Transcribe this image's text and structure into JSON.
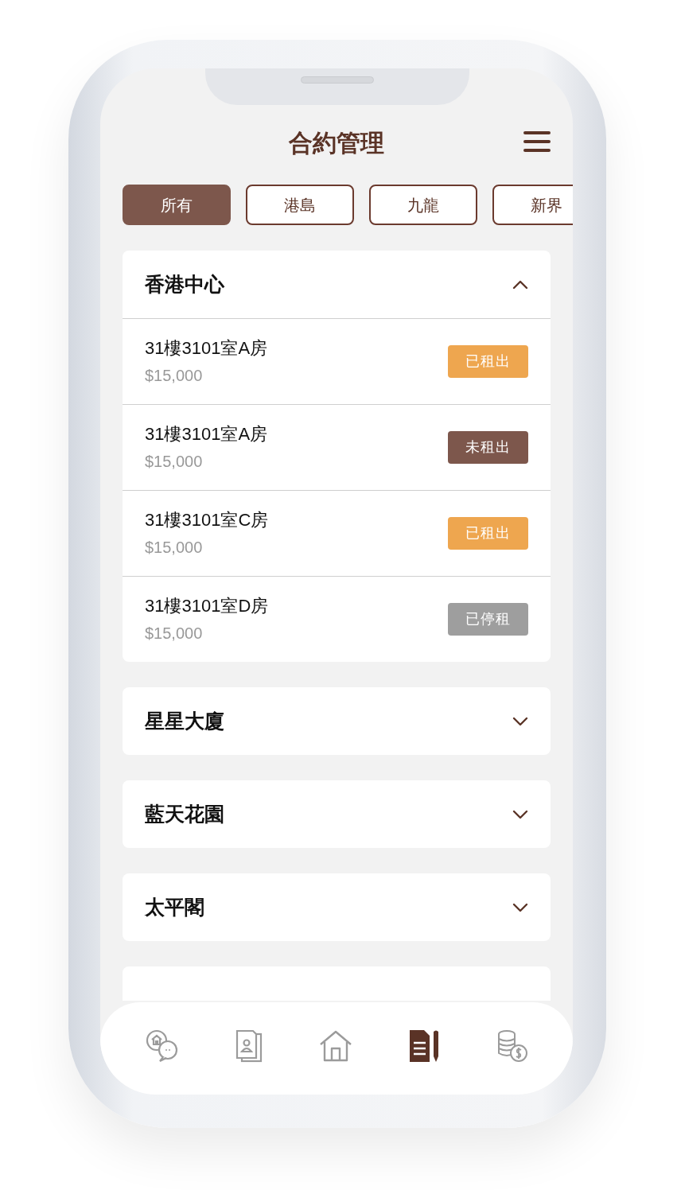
{
  "title": "合約管理",
  "tabs": [
    {
      "label": "所有",
      "selected": true
    },
    {
      "label": "港島",
      "selected": false
    },
    {
      "label": "九龍",
      "selected": false
    },
    {
      "label": "新界",
      "selected": false
    }
  ],
  "buildings": [
    {
      "name": "香港中心",
      "expanded": true,
      "units": [
        {
          "name": "31樓3101室A房",
          "price": "$15,000",
          "status": "已租出",
          "kind": "rented"
        },
        {
          "name": "31樓3101室A房",
          "price": "$15,000",
          "status": "未租出",
          "kind": "vacant"
        },
        {
          "name": "31樓3101室C房",
          "price": "$15,000",
          "status": "已租出",
          "kind": "rented"
        },
        {
          "name": "31樓3101室D房",
          "price": "$15,000",
          "status": "已停租",
          "kind": "stopped"
        }
      ]
    },
    {
      "name": "星星大廈",
      "expanded": false
    },
    {
      "name": "藍天花園",
      "expanded": false
    },
    {
      "name": "太平閣",
      "expanded": false
    },
    {
      "kind": "partial"
    }
  ],
  "nav": [
    {
      "kind": "chat",
      "selected": false
    },
    {
      "kind": "contacts",
      "selected": false
    },
    {
      "kind": "home",
      "selected": false
    },
    {
      "kind": "contract",
      "selected": true
    },
    {
      "kind": "money",
      "selected": false
    }
  ]
}
